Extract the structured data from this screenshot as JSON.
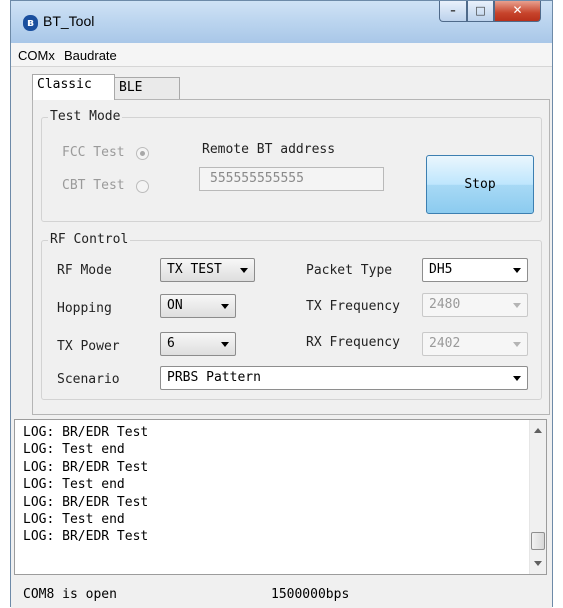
{
  "window": {
    "title": "BT_Tool",
    "app_icon": "bluetooth-icon",
    "controls": {
      "minimize_icon": "minimize-icon",
      "maximize_icon": "maximize-icon",
      "close_icon": "close-icon"
    }
  },
  "menu": {
    "items": [
      "COMx",
      "Baudrate"
    ]
  },
  "tabs": [
    {
      "label": "Classic",
      "selected": true
    },
    {
      "label": "BLE",
      "selected": false
    }
  ],
  "test_mode": {
    "title": "Test Mode",
    "fcc_label": "FCC Test",
    "fcc_checked": true,
    "cbt_label": "CBT Test",
    "cbt_checked": false,
    "remote_label": "Remote BT address",
    "remote_value": "555555555555",
    "stop_label": "Stop"
  },
  "rf_control": {
    "title": "RF Control",
    "rf_mode_label": "RF Mode",
    "rf_mode_value": "TX TEST",
    "hopping_label": "Hopping",
    "hopping_value": "ON",
    "tx_power_label": "TX Power",
    "tx_power_value": "6",
    "scenario_label": "Scenario",
    "scenario_value": "PRBS Pattern",
    "packet_type_label": "Packet Type",
    "packet_type_value": "DH5",
    "tx_freq_label": "TX Frequency",
    "tx_freq_value": "2480",
    "rx_freq_label": "RX Frequency",
    "rx_freq_value": "2402"
  },
  "log": {
    "lines": [
      "LOG: BR/EDR Test",
      "LOG: Test end",
      "LOG: BR/EDR Test",
      "LOG: Test end",
      "LOG: BR/EDR Test",
      "LOG: Test end",
      "LOG: BR/EDR Test"
    ]
  },
  "status": {
    "port": "COM8 is open",
    "baud": "1500000bps"
  },
  "colors": {
    "title_bar": "#b9d3ee",
    "stop_button": "#bee6fd",
    "close_button": "#c7442c"
  }
}
